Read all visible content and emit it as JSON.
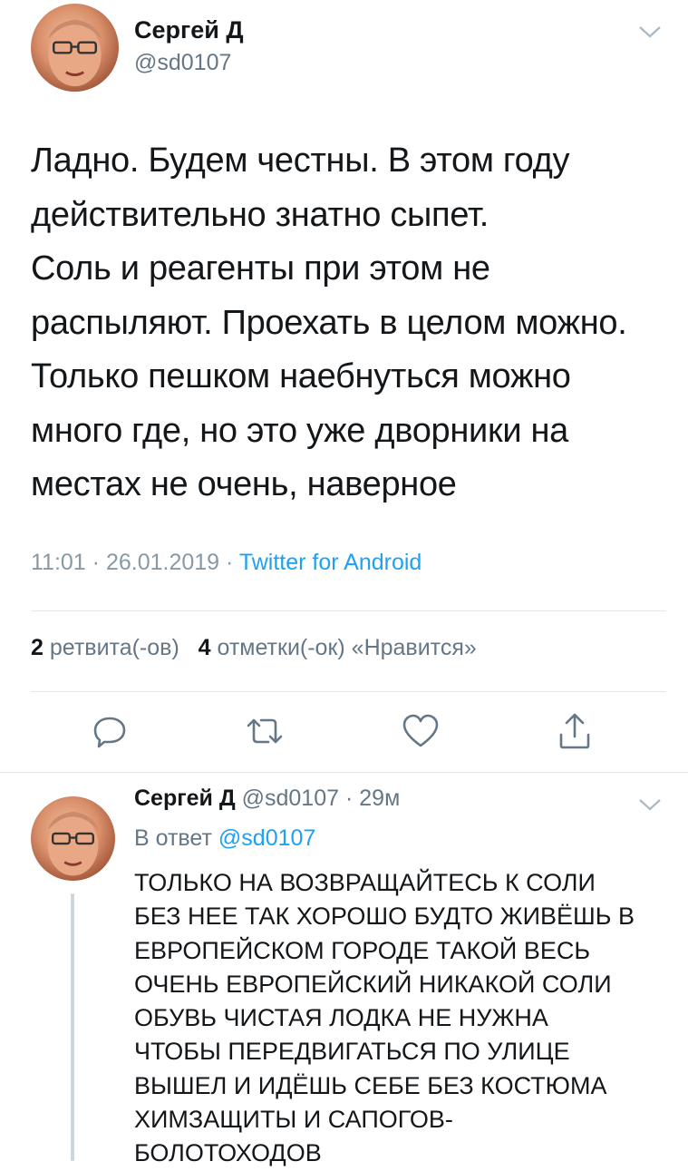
{
  "tweet": {
    "author_name": "Сергей Д",
    "author_handle": "@sd0107",
    "lines": [
      "Ладно. Будем честны. В этом году",
      "действительно знатно сыпет.",
      "Соль и реагенты при этом не",
      "распыляют. Проехать в целом можно.",
      "Только пешком наебнуться можно",
      "много где, но это уже дворники на",
      "местах не очень, наверное"
    ],
    "time": "11:01",
    "date": "26.01.2019",
    "source": "Twitter for Android",
    "separator": "·",
    "retweets_count": "2",
    "retweets_label": "ретвита(-ов)",
    "likes_count": "4",
    "likes_label": "отметки(-ок) «Нравится»"
  },
  "actions": {
    "reply": "reply-icon",
    "retweet": "retweet-icon",
    "like": "heart-icon",
    "share": "share-icon"
  },
  "reply": {
    "author_name": "Сергей Д",
    "author_handle": "@sd0107",
    "separator": "·",
    "age": "29м",
    "in_reply_prefix": "В ответ",
    "in_reply_handle": "@sd0107",
    "lines": [
      "ТОЛЬКО НА ВОЗВРАЩАЙТЕСЬ К СОЛИ",
      "БЕЗ НЕЕ ТАК ХОРОШО БУДТО ЖИВЁШЬ В",
      "ЕВРОПЕЙСКОМ ГОРОДЕ ТАКОЙ ВЕСЬ",
      "ОЧЕНЬ ЕВРОПЕЙСКИЙ НИКАКОЙ СОЛИ",
      "ОБУВЬ ЧИСТАЯ ЛОДКА НЕ НУЖНА",
      "ЧТОБЫ ПЕРЕДВИГАТЬСЯ ПО УЛИЦЕ",
      "ВЫШЕЛ И ИДЁШЬ СЕБЕ БЕЗ КОСТЮМА",
      "ХИМЗАЩИТЫ И САПОГОВ-",
      "БОЛОТОХОДОВ"
    ]
  },
  "colors": {
    "accent": "#1da1f2",
    "muted": "#657786",
    "divider": "#e1e8ed"
  }
}
